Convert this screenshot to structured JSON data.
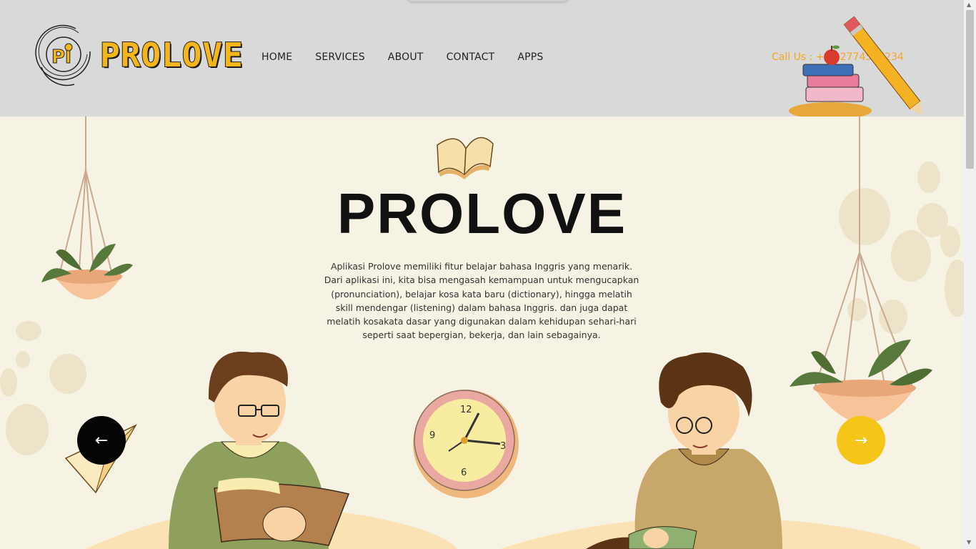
{
  "brand": {
    "name": "PROLOVE"
  },
  "nav": {
    "items": [
      {
        "label": "HOME"
      },
      {
        "label": "SERVICES"
      },
      {
        "label": "ABOUT"
      },
      {
        "label": "CONTACT"
      },
      {
        "label": "APPS"
      }
    ]
  },
  "header": {
    "call_text": "Call Us : +01 2774567234"
  },
  "hero": {
    "title": "PROLOVE",
    "description": "Aplikasi Prolove memiliki fitur belajar bahasa Inggris yang menarik. Dari aplikasi ini, kita bisa mengasah kemampuan untuk mengucapkan (pronunciation), belajar kosa kata baru (dictionary), hingga melatih skill mendengar (listening) dalam bahasa Inggris. dan juga dapat melatih kosakata dasar yang digunakan dalam kehidupan sehari-hari seperti saat bepergian, bekerja, dan lain sebagainya.",
    "prev_label": "←",
    "next_label": "→"
  },
  "clock": {
    "labels": [
      "12",
      "3",
      "6",
      "9"
    ]
  },
  "colors": {
    "accent": "#f5c518",
    "call_text": "#f5a524",
    "header_bg": "#d9d9d9",
    "hero_bg": "#f7f3e4"
  },
  "icons": {
    "logo": "prolove-logo-icon",
    "book": "open-book-icon",
    "clock": "wall-clock-icon",
    "prev": "arrow-left-icon",
    "next": "arrow-right-icon"
  }
}
